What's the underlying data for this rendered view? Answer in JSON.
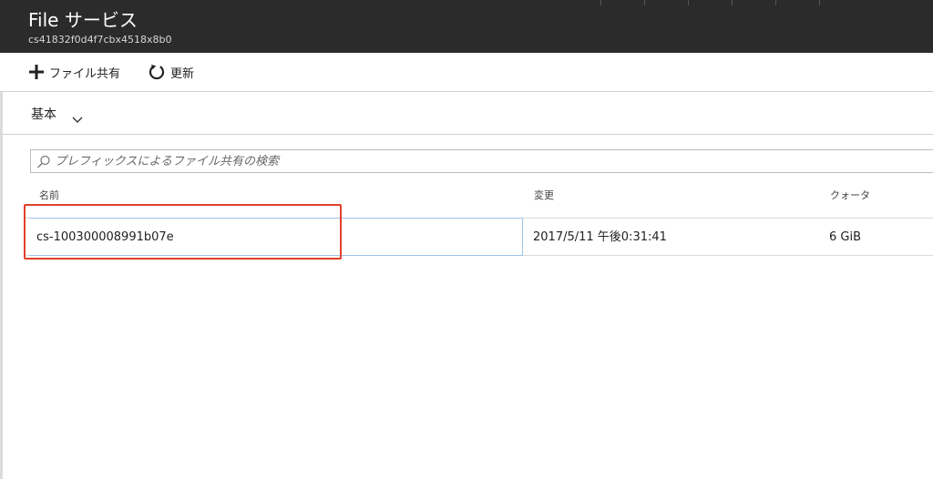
{
  "header": {
    "title": "File サービス",
    "subtitle": "cs41832f0d4f7cbx4518x8b0"
  },
  "toolbar": {
    "add_label": "ファイル共有",
    "refresh_label": "更新",
    "add_icon": "plus-icon",
    "refresh_icon": "refresh-icon"
  },
  "section": {
    "title": "基本",
    "icon": "chevron-down-icon"
  },
  "search": {
    "placeholder": "プレフィックスによるファイル共有の検索",
    "value": "",
    "icon": "search-icon"
  },
  "table": {
    "columns": [
      "名前",
      "変更",
      "クォータ"
    ],
    "rows": [
      {
        "name": "cs-100300008991b07e",
        "modified": "2017/5/11 午後0:31:41",
        "quota": "6 GiB"
      }
    ]
  },
  "colors": {
    "header_bg": "#2b2b2b",
    "highlight": "#e0412b",
    "focus_border": "#9ec3e6"
  }
}
